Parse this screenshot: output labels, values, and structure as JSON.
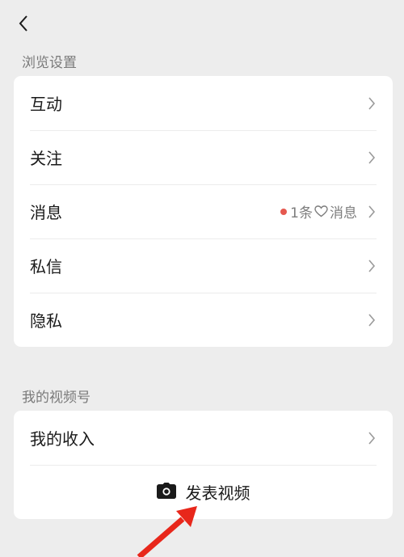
{
  "browse_settings": {
    "title": "浏览设置",
    "items": [
      {
        "label": "互动"
      },
      {
        "label": "关注"
      },
      {
        "label": "消息",
        "badge_count": "1条",
        "badge_suffix": "消息"
      },
      {
        "label": "私信"
      },
      {
        "label": "隐私"
      }
    ]
  },
  "channels": {
    "title": "我的视频号",
    "income_label": "我的收入",
    "post_video_label": "发表视频"
  },
  "colors": {
    "background": "#ededed",
    "card": "#ffffff",
    "notification_dot": "#e5584f",
    "annotation_arrow": "#e8271b"
  },
  "icons": {
    "back": "chevron-left-icon",
    "row_arrow": "chevron-right-icon",
    "heart": "heart-outline-icon",
    "camera": "camera-icon"
  }
}
